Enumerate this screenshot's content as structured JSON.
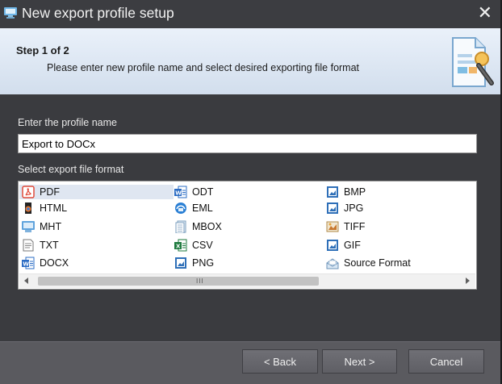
{
  "window": {
    "title": "New export profile setup",
    "close_glyph": "✕"
  },
  "header": {
    "step": "Step 1 of 2",
    "description": "Please enter new profile name and select desired exporting file format",
    "icon": "wizard-document-icon"
  },
  "profile_name": {
    "label": "Enter the profile name",
    "value": "Export to DOCx"
  },
  "format_list": {
    "label": "Select export file format",
    "selected": "PDF",
    "items": [
      {
        "label": "PDF",
        "icon": "pdf-icon"
      },
      {
        "label": "HTML",
        "icon": "html-icon"
      },
      {
        "label": "MHT",
        "icon": "mht-icon"
      },
      {
        "label": "TXT",
        "icon": "txt-icon"
      },
      {
        "label": "DOCX",
        "icon": "docx-icon"
      },
      {
        "label": "ODT",
        "icon": "odt-icon"
      },
      {
        "label": "EML",
        "icon": "eml-icon"
      },
      {
        "label": "MBOX",
        "icon": "mbox-icon"
      },
      {
        "label": "CSV",
        "icon": "csv-icon"
      },
      {
        "label": "PNG",
        "icon": "png-icon"
      },
      {
        "label": "BMP",
        "icon": "bmp-icon"
      },
      {
        "label": "JPG",
        "icon": "jpg-icon"
      },
      {
        "label": "TIFF",
        "icon": "tiff-icon"
      },
      {
        "label": "GIF",
        "icon": "gif-icon"
      },
      {
        "label": "Source Format",
        "icon": "source-format-icon"
      }
    ],
    "scrollbar_grip": "III"
  },
  "buttons": {
    "back": "< Back",
    "next": "Next >",
    "cancel": "Cancel"
  },
  "colors": {
    "titlebar": "#3c3d41",
    "body": "#3a3b3f",
    "footer": "#5a5a5f",
    "selection": "#dfe6f1"
  }
}
